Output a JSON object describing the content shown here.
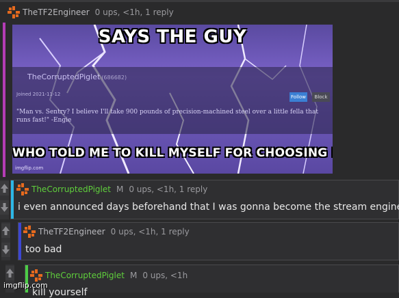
{
  "comments": [
    {
      "username": "TheTF2Engineer",
      "username_color": "#b9b9bd",
      "bar_color": "#b43cb4",
      "meta": "0 ups, <1h, 1 reply",
      "meme": {
        "top_caption": "SAYS THE GUY",
        "bottom_caption": "WHO TOLD ME TO KILL MYSELF FOR CHOOSING ENGINEER",
        "inner_username": "TheCorruptedPiglet",
        "inner_id": "(686682)",
        "inner_joined": "Joined 2021-11-12",
        "inner_button1": "Follow",
        "inner_button2": "Block",
        "inner_quote": "\"Man vs. Sentry? I believe I'll take 900 pounds of precision-machined steel over a little fella that runs fast!\" -Engie",
        "watermark": "imgflip.com"
      }
    },
    {
      "username": "TheCorruptedPiglet",
      "username_color": "#5fce3c",
      "bar_color": "#2db7e6",
      "mod_label": "M",
      "meta": "0 ups, <1h, 1 reply",
      "text": "i even announced days beforehand that I was gonna become the stream engineer"
    },
    {
      "username": "TheTF2Engineer",
      "username_color": "#b9b9bd",
      "bar_color": "#3c46d2",
      "meta": "0 ups, <1h, 1 reply",
      "text": "too bad"
    },
    {
      "username": "TheCorruptedPiglet",
      "username_color": "#5fce3c",
      "bar_color": "#4ccc46",
      "mod_label": "M",
      "meta": "0 ups, <1h",
      "text": "kill yourself"
    }
  ],
  "icons": {
    "avatar": "orange-crosshair-avatar-icon",
    "upvote": "up-arrow-icon",
    "downvote": "down-arrow-icon"
  },
  "site_watermark": "imgflip.com"
}
